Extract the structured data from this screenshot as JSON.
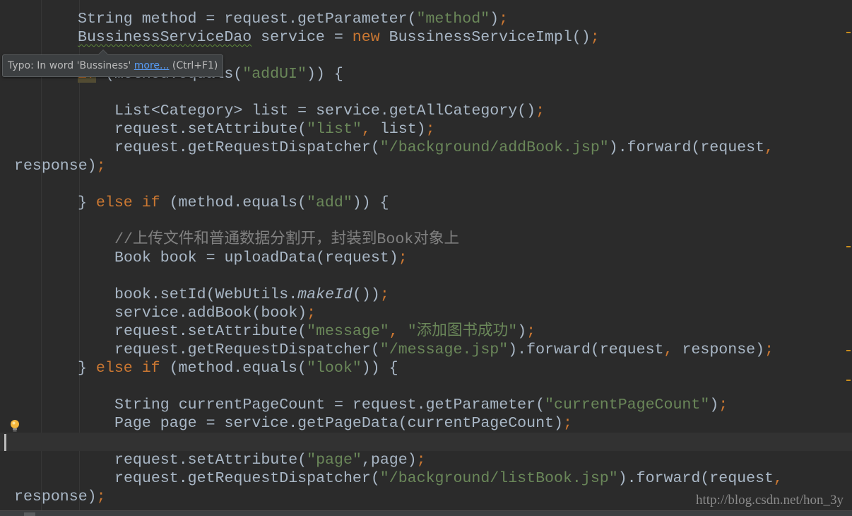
{
  "editor": {
    "colors": {
      "background": "#2b2b2b",
      "text": "#a9b7c6",
      "keyword": "#cc7832",
      "string": "#6a8759",
      "comment": "#808080",
      "current_line": "#323232"
    },
    "current_line_index": 23,
    "lines": [
      {
        "indent": 110,
        "tokens": [
          [
            "String method = request.getParameter(",
            ""
          ],
          [
            "\"method\"",
            "str"
          ],
          [
            ")",
            ""
          ],
          [
            ";",
            "kw"
          ]
        ]
      },
      {
        "indent": 110,
        "tokens": [
          [
            "BussinessServiceDao",
            "typo"
          ],
          [
            " service = ",
            ""
          ],
          [
            "new",
            "kw"
          ],
          [
            " BussinessServiceImpl()",
            ""
          ],
          [
            ";",
            "kw"
          ]
        ]
      },
      {
        "indent": 110,
        "tokens": []
      },
      {
        "indent": 110,
        "tokens": [
          [
            "if",
            "hl"
          ],
          [
            " (method.equals(",
            ""
          ],
          [
            "\"addUI\"",
            "str"
          ],
          [
            ")) {",
            ""
          ]
        ]
      },
      {
        "indent": 110,
        "tokens": []
      },
      {
        "indent": 162,
        "tokens": [
          [
            "List<Category> list = service.getAllCategory()",
            ""
          ],
          [
            ";",
            "kw"
          ]
        ]
      },
      {
        "indent": 162,
        "tokens": [
          [
            "request.setAttribute(",
            ""
          ],
          [
            "\"list\"",
            "str"
          ],
          [
            ",",
            "kw"
          ],
          [
            " list)",
            ""
          ],
          [
            ";",
            "kw"
          ]
        ]
      },
      {
        "indent": 162,
        "tokens": [
          [
            "request.getRequestDispatcher(",
            ""
          ],
          [
            "\"/background/addBook.jsp\"",
            "str"
          ],
          [
            ").forward(request",
            ""
          ],
          [
            ",",
            "kw"
          ]
        ]
      },
      {
        "indent": 20,
        "tokens": [
          [
            "response)",
            ""
          ],
          [
            ";",
            "kw"
          ]
        ]
      },
      {
        "indent": 110,
        "tokens": []
      },
      {
        "indent": 110,
        "tokens": [
          [
            "} ",
            ""
          ],
          [
            "else if",
            "kw"
          ],
          [
            " (method.equals(",
            ""
          ],
          [
            "\"add\"",
            "str"
          ],
          [
            ")) {",
            ""
          ]
        ]
      },
      {
        "indent": 110,
        "tokens": []
      },
      {
        "indent": 162,
        "tokens": [
          [
            "//上传文件和普通数据分割开，封装到Book对象上",
            "com"
          ]
        ]
      },
      {
        "indent": 162,
        "tokens": [
          [
            "Book book = uploadData(request)",
            ""
          ],
          [
            ";",
            "kw"
          ]
        ]
      },
      {
        "indent": 162,
        "tokens": []
      },
      {
        "indent": 162,
        "tokens": [
          [
            "book.setId(WebUtils.",
            ""
          ],
          [
            "makeId",
            "it"
          ],
          [
            "())",
            ""
          ],
          [
            ";",
            "kw"
          ]
        ]
      },
      {
        "indent": 162,
        "tokens": [
          [
            "service.addBook(book)",
            ""
          ],
          [
            ";",
            "kw"
          ]
        ]
      },
      {
        "indent": 162,
        "tokens": [
          [
            "request.setAttribute(",
            ""
          ],
          [
            "\"message\"",
            "str"
          ],
          [
            ", ",
            "kw"
          ],
          [
            "\"添加图书成功\"",
            "str"
          ],
          [
            ")",
            ""
          ],
          [
            ";",
            "kw"
          ]
        ]
      },
      {
        "indent": 162,
        "tokens": [
          [
            "request.getRequestDispatcher(",
            ""
          ],
          [
            "\"/message.jsp\"",
            "str"
          ],
          [
            ").forward(request",
            ""
          ],
          [
            ", ",
            "kw"
          ],
          [
            "response)",
            ""
          ],
          [
            ";",
            "kw"
          ]
        ]
      },
      {
        "indent": 110,
        "tokens": [
          [
            "} ",
            ""
          ],
          [
            "else if",
            "kw"
          ],
          [
            " (method.equals(",
            ""
          ],
          [
            "\"look\"",
            "str"
          ],
          [
            ")) {",
            ""
          ]
        ]
      },
      {
        "indent": 110,
        "tokens": []
      },
      {
        "indent": 162,
        "tokens": [
          [
            "String currentPageCount = request.getParameter(",
            ""
          ],
          [
            "\"currentPageCount\"",
            "str"
          ],
          [
            ")",
            ""
          ],
          [
            ";",
            "kw"
          ]
        ]
      },
      {
        "indent": 162,
        "tokens": [
          [
            "Page page = service.getPageData(currentPageCount)",
            ""
          ],
          [
            ";",
            "kw"
          ]
        ]
      },
      {
        "indent": 162,
        "tokens": []
      },
      {
        "indent": 162,
        "tokens": [
          [
            "request.setAttribute(",
            ""
          ],
          [
            "\"page\"",
            "str"
          ],
          [
            ",page)",
            ""
          ],
          [
            ";",
            "kw"
          ]
        ]
      },
      {
        "indent": 162,
        "tokens": [
          [
            "request.getRequestDispatcher(",
            ""
          ],
          [
            "\"/background/listBook.jsp\"",
            "str"
          ],
          [
            ").forward(request",
            ""
          ],
          [
            ",",
            "kw"
          ]
        ]
      },
      {
        "indent": 20,
        "tokens": [
          [
            "response)",
            ""
          ],
          [
            ";",
            "kw"
          ]
        ]
      }
    ]
  },
  "tooltip": {
    "text": "Typo: In word 'Bussiness' ",
    "link": "more...",
    "shortcut": " (Ctrl+F1)"
  },
  "icons": {
    "intention": "lightbulb-icon"
  },
  "watermark": "http://blog.csdn.net/hon_3y"
}
